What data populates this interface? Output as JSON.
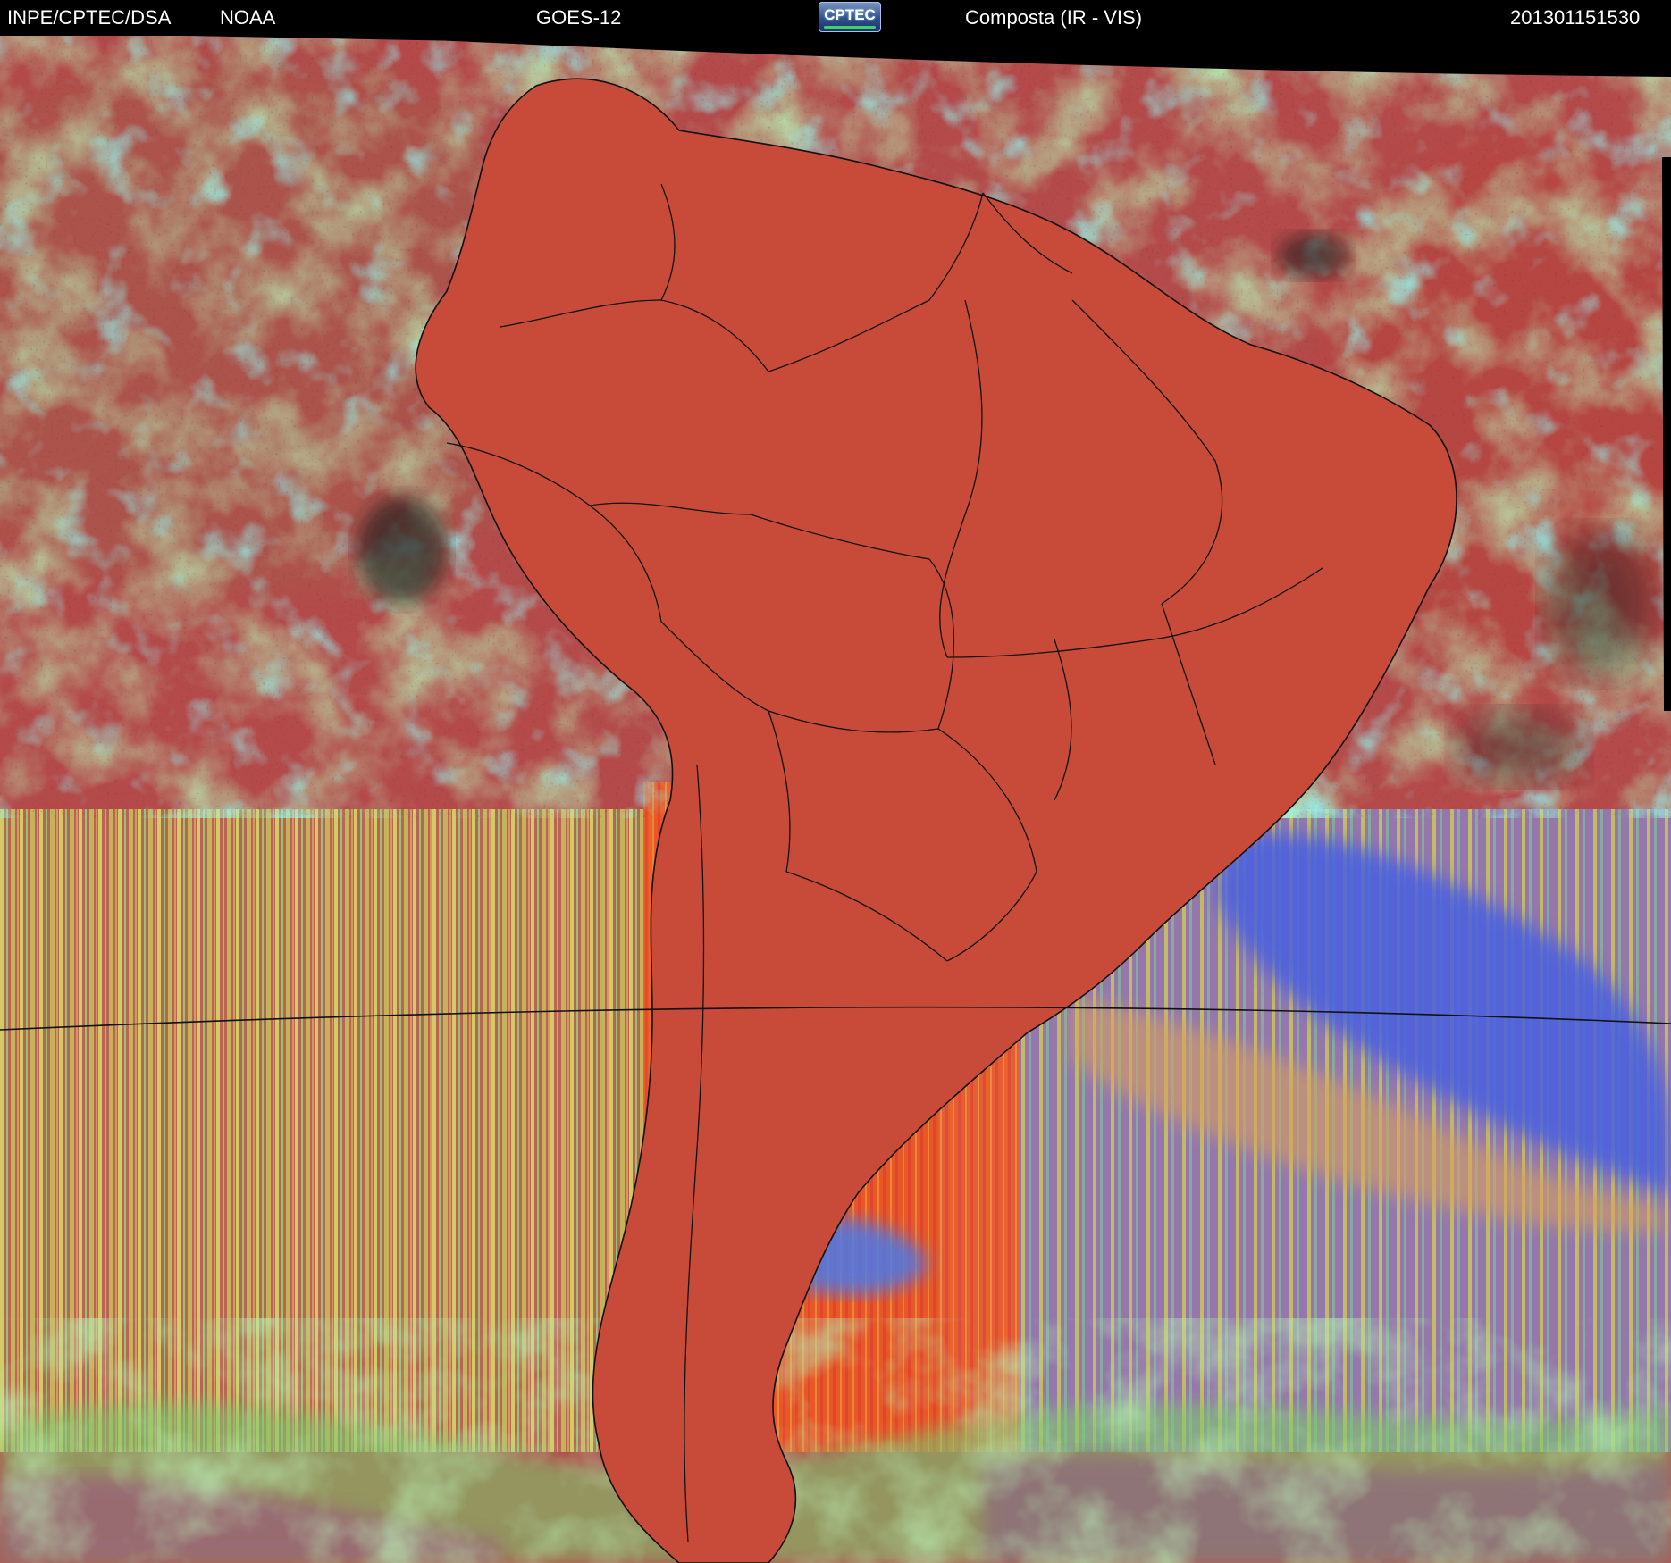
{
  "header": {
    "agency": "INPE/CPTEC/DSA",
    "source": "NOAA",
    "satellite": "GOES-12",
    "logo_text": "CPTEC",
    "product": "Composta (IR - VIS)",
    "timestamp": "201301151530"
  },
  "colors": {
    "ocean_clear": "#b44a4a",
    "land_warm": "#d8573a",
    "cloud_low": "#86d06a",
    "cloud_high": "#4ef2ec",
    "cloud_cold_blue": "#4a6ee6",
    "stripe_yellow": "#d7dd5a",
    "border_lines": "#111111"
  },
  "icons": {
    "logo": "cptec-logo"
  }
}
